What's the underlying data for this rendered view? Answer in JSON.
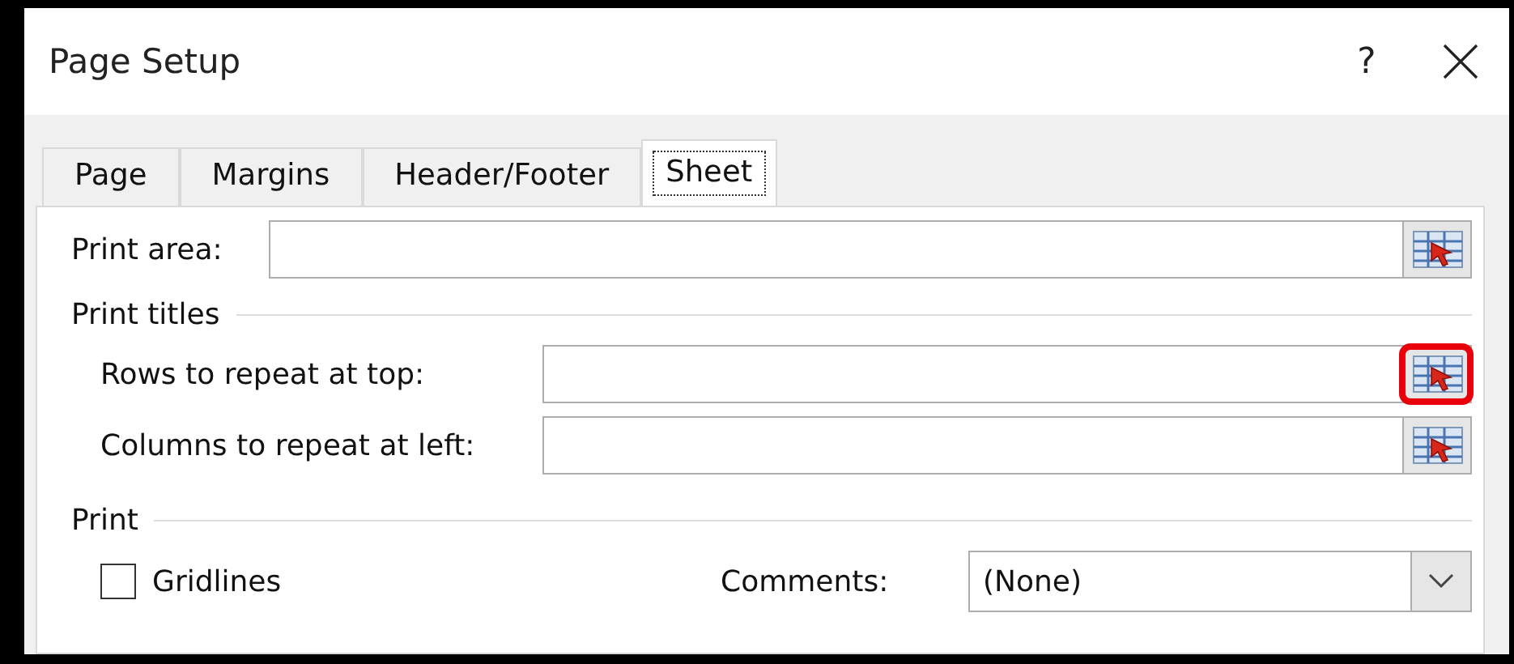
{
  "window": {
    "title": "Page Setup",
    "help": "?"
  },
  "tabs": [
    {
      "label": "Page",
      "selected": false
    },
    {
      "label": "Margins",
      "selected": false
    },
    {
      "label": "Header/Footer",
      "selected": false
    },
    {
      "label": "Sheet",
      "selected": true
    }
  ],
  "print_area": {
    "label": "Print area:",
    "highlighted": false
  },
  "print_titles": {
    "heading": "Print titles",
    "fields": [
      {
        "label": "Rows to repeat at top:",
        "highlighted": true
      },
      {
        "label": "Columns to repeat at left:",
        "highlighted": false
      }
    ]
  },
  "print": {
    "heading": "Print",
    "gridlines": {
      "label": "Gridlines",
      "checked": false
    },
    "comments": {
      "label": "Comments:",
      "value": "(None)"
    }
  }
}
